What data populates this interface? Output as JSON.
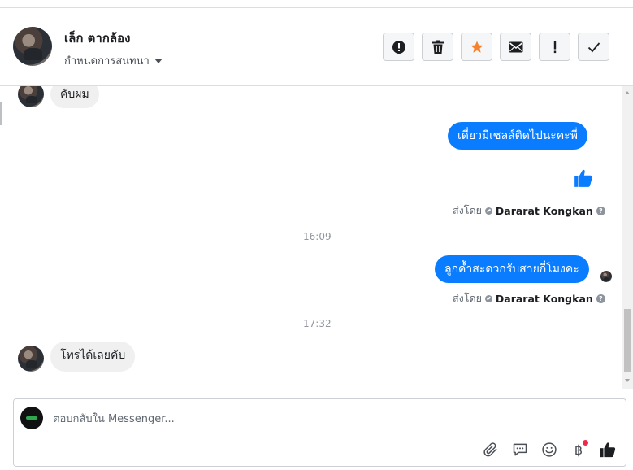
{
  "header": {
    "contact_name": "เล็ก ตากล้อง",
    "assign_label": "กำหนดการสนทนา",
    "actions": [
      {
        "icon": "alert-circle-icon",
        "label": "Mark as spam"
      },
      {
        "icon": "trash-icon",
        "label": "Delete"
      },
      {
        "icon": "star-icon",
        "label": "Follow up"
      },
      {
        "icon": "envelope-icon",
        "label": "Mark as unread"
      },
      {
        "icon": "exclamation-icon",
        "label": "Mark important"
      },
      {
        "icon": "check-icon",
        "label": "Mark as done"
      }
    ]
  },
  "thread": {
    "msg1": "คับผม",
    "msg2": "เดี๋ยวมีเซลล์ติดไปนะคะพี่",
    "sent_by_label": "ส่งโดย",
    "agent_name": "Dararat Kongkan",
    "time1": "16:09",
    "msg3": "ลูกค้ำสะดวกรับสายกี่โมงคะ",
    "time2": "17:32",
    "msg4": "โทรได้เลยคับ"
  },
  "composer": {
    "placeholder": "ตอบกลับใน Messenger..."
  },
  "colors": {
    "outgoing_bubble": "#0a7cff",
    "incoming_bubble": "#f0f0f0",
    "star_accent": "#f5822e",
    "notification_dot": "#f02849"
  }
}
